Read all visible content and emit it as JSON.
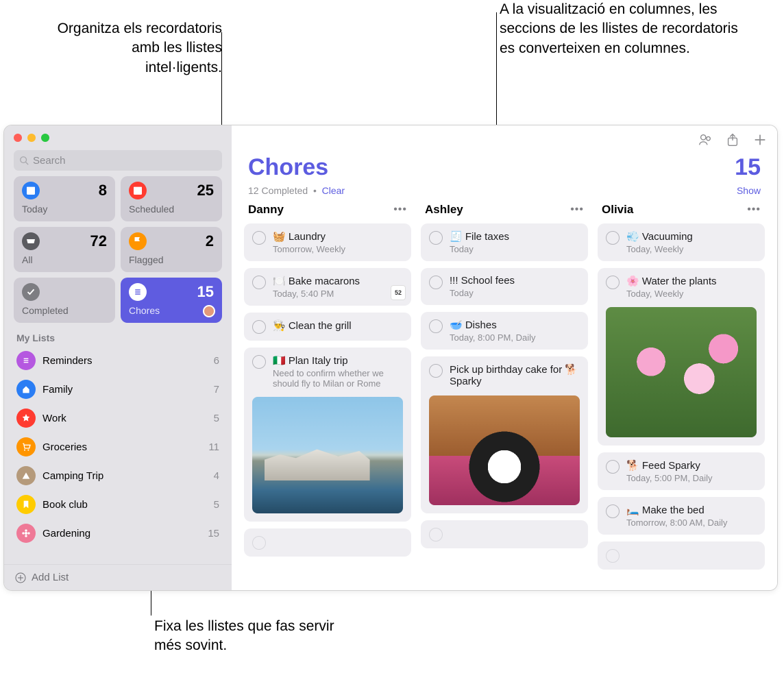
{
  "callouts": {
    "topLeft": "Organitza els recordatoris amb les llistes intel·ligents.",
    "topRight": "A la visualització en columnes, les seccions de les llistes de recordatoris es converteixen en columnes.",
    "bottom": "Fixa les llistes que fas servir més sovint."
  },
  "search": {
    "placeholder": "Search"
  },
  "smartLists": [
    {
      "id": "today",
      "label": "Today",
      "count": 8,
      "color": "#2a7df4",
      "icon": "calendar"
    },
    {
      "id": "scheduled",
      "label": "Scheduled",
      "count": 25,
      "color": "#ff3b30",
      "icon": "calendar"
    },
    {
      "id": "all",
      "label": "All",
      "count": 72,
      "color": "#5b5b60",
      "icon": "tray"
    },
    {
      "id": "flagged",
      "label": "Flagged",
      "count": 2,
      "color": "#ff9500",
      "icon": "flag"
    },
    {
      "id": "completed",
      "label": "Completed",
      "count": "",
      "color": "#7d7d82",
      "icon": "check"
    },
    {
      "id": "chores",
      "label": "Chores",
      "count": 15,
      "color": "#5f5ce0",
      "icon": "list",
      "active": true,
      "avatar": true
    }
  ],
  "sectionTitle": "My Lists",
  "myLists": [
    {
      "name": "Reminders",
      "count": 6,
      "color": "#b558e0",
      "icon": "list"
    },
    {
      "name": "Family",
      "count": 7,
      "color": "#2a7df4",
      "icon": "home"
    },
    {
      "name": "Work",
      "count": 5,
      "color": "#ff3b30",
      "icon": "star"
    },
    {
      "name": "Groceries",
      "count": 11,
      "color": "#ff9500",
      "icon": "cart"
    },
    {
      "name": "Camping Trip",
      "count": 4,
      "color": "#b59a7b",
      "icon": "tent"
    },
    {
      "name": "Book club",
      "count": 5,
      "color": "#ffcc00",
      "icon": "bookmark"
    },
    {
      "name": "Gardening",
      "count": 15,
      "color": "#ef7997",
      "icon": "flower"
    }
  ],
  "addList": "Add List",
  "header": {
    "title": "Chores",
    "count": 15,
    "completedText": "12 Completed",
    "clear": "Clear",
    "show": "Show"
  },
  "columns": [
    {
      "name": "Danny",
      "items": [
        {
          "title": "🧺 Laundry",
          "meta": "Tomorrow, Weekly"
        },
        {
          "title": "🍽️ Bake macarons",
          "meta": "Today, 5:40 PM",
          "calendar": "52"
        },
        {
          "title": "👨‍🍳 Clean the grill"
        },
        {
          "title": "🇮🇹 Plan Italy trip",
          "notes": "Need to confirm whether we should fly to Milan or Rome",
          "image": "sea"
        }
      ],
      "empty": true
    },
    {
      "name": "Ashley",
      "items": [
        {
          "title": "🧾 File taxes",
          "meta": "Today"
        },
        {
          "title": "!!! School fees",
          "meta": "Today"
        },
        {
          "title": "🥣 Dishes",
          "meta": "Today, 8:00 PM, Daily"
        },
        {
          "title": "Pick up birthday cake for 🐕 Sparky",
          "image": "dog"
        }
      ],
      "empty": true
    },
    {
      "name": "Olivia",
      "items": [
        {
          "title": "💨 Vacuuming",
          "meta": "Today, Weekly"
        },
        {
          "title": "🌸 Water the plants",
          "meta": "Today, Weekly",
          "image": "flower"
        },
        {
          "title": "🐕 Feed Sparky",
          "meta": "Today, 5:00 PM, Daily"
        },
        {
          "title": "🛏️ Make the bed",
          "meta": "Tomorrow, 8:00 AM, Daily"
        }
      ],
      "empty": true
    }
  ]
}
